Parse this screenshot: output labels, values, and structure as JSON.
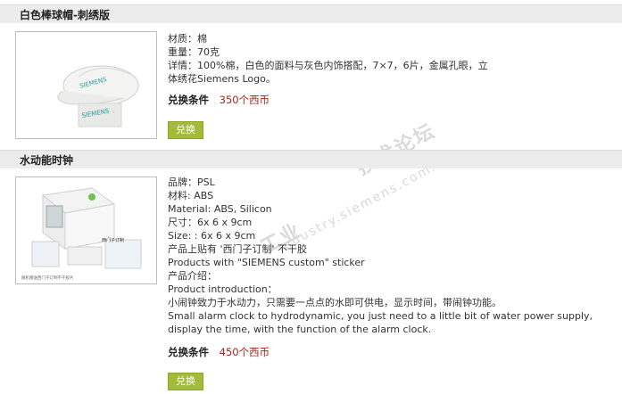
{
  "products": [
    {
      "title": "白色棒球帽-刺绣版",
      "details": [
        " 材质：棉",
        "重量：70克",
        "详情：100%棉，白色的面料与灰色内饰搭配，7×7，6片，金属孔眼，立",
        "体绣花Siemens Logo。"
      ],
      "price_label": "兑换条件",
      "price_value": "350个西币",
      "button_label": "兑换",
      "image_logo_text": "SIEMENS"
    },
    {
      "title": "水动能时钟",
      "details": [
        " 品牌：PSL",
        "材料: ABS",
        "Material: ABS, Silicon",
        "尺寸：6x 6 x 9cm",
        "Size: : 6x 6 x 9cm",
        "产品上贴有 '西门子订制' 不干胶",
        "Products with \"SIEMENS custom\" sticker",
        "产品介绍：",
        "Product introduction：",
        "小闹钟致力于水动力，只需要一点点的水即可供电，显示时间，带闹钟功能。",
        "Small alarm clock to hydrodynamic, you just need to a little bit of water power supply,",
        "display the time, with the function of the alarm clock."
      ],
      "price_label": "兑换条件",
      "price_value": "450个西币",
      "button_label": "兑换",
      "image_label": "西门子订制",
      "image_caption": "随机赠送西门子订制不干胶片"
    }
  ],
  "watermark": {
    "line1": "工业",
    "line2": "技术论坛",
    "url": "industry.siemens.com.cn"
  }
}
